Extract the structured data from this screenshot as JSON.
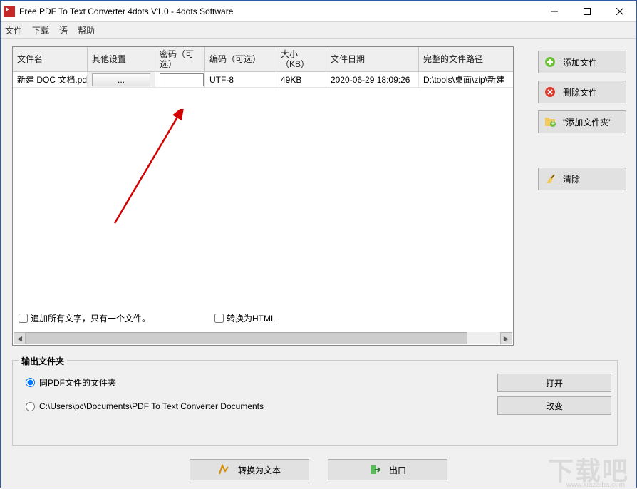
{
  "title": "Free PDF To Text Converter 4dots V1.0 - 4dots Software",
  "menu": {
    "file": "文件",
    "download": "下载",
    "lang": "语",
    "help": "帮助"
  },
  "columns": {
    "name": "文件名",
    "other": "其他设置",
    "pwd": "密码（可选）",
    "enc": "编码（可选）",
    "size": "大小（KB）",
    "date": "文件日期",
    "path": "完整的文件路径"
  },
  "rows": [
    {
      "name": "新建 DOC 文档.pdf",
      "other": "...",
      "pwd": "",
      "enc": "UTF-8",
      "size": "49KB",
      "date": "2020-06-29 18:09:26",
      "path": "D:\\tools\\桌面\\zip\\新建"
    }
  ],
  "checks": {
    "append": "追加所有文字，只有一个文件。",
    "html": "转换为HTML"
  },
  "side": {
    "add": "添加文件",
    "del": "删除文件",
    "folder": "\"添加文件夹\"",
    "clear": "清除"
  },
  "output": {
    "legend": "输出文件夹",
    "same": "同PDF文件的文件夹",
    "path": "C:\\Users\\pc\\Documents\\PDF To Text Converter Documents",
    "open": "打开",
    "change": "改变"
  },
  "footer": {
    "convert": "转换为文本",
    "exit": "出口"
  },
  "watermark": "下载吧",
  "watermark_url": "www.xiazaiba.com"
}
